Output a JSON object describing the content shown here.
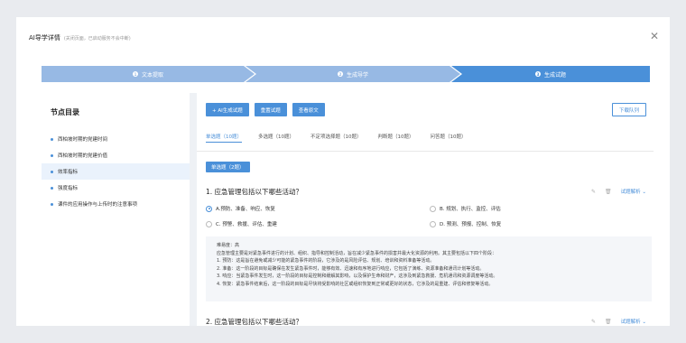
{
  "header": {
    "title": "AI导学详情",
    "subtitle": "(关闭页面，已启动服务不会中断)"
  },
  "steps": [
    {
      "num": "1",
      "label": "文本提取"
    },
    {
      "num": "2",
      "label": "生成导学"
    },
    {
      "num": "3",
      "label": "生成试题"
    }
  ],
  "sidebar": {
    "title": "节点目录",
    "items": [
      {
        "label": "西柏坡时期的党建时间"
      },
      {
        "label": "西柏坡时期的党建价值"
      },
      {
        "label": "效率指标"
      },
      {
        "label": "强度指标"
      },
      {
        "label": "课件的应用操作与上传时的注意事项"
      }
    ]
  },
  "toolbar": {
    "ai_generate": "+ AI生成试题",
    "regenerate": "重置试题",
    "view_original": "查看原文",
    "download": "下载队列"
  },
  "tabs": [
    {
      "label": "单选题（10题）"
    },
    {
      "label": "多选题（10题）"
    },
    {
      "label": "不定项选择题（10题）"
    },
    {
      "label": "判断题（10题）"
    },
    {
      "label": "问答题（10题）"
    }
  ],
  "section": {
    "badge": "单选题（2题）"
  },
  "questions": [
    {
      "title": "1. 应急管理包括以下哪些活动？",
      "options": [
        "A.预防、准备、响应、恢复",
        "B. 规划、执行、监控、评估",
        "C. 预警、救援、评估、重建",
        "D. 预测、预报、控制、恢复"
      ],
      "analysis_label": "试题解析 ⌄",
      "difficulty": "难易度：高",
      "explanation": [
        "应急管理主要是对紧急事件进行的计划、组织、指导和控制活动，旨在减少紧急事件的损害并最大化资源的利用。其主要包括以下四个阶段：",
        "1. 预防：这是旨在避免或减少可能的紧急事件的阶段，它涉及的是风险评估、规划、培训和资料准备等活动。",
        "2. 准备：这一阶段的目标是确保在发生紧急事件时，能够有效、迅速和有序地进行响应，它包括了演练、资源准备和通讯计划等活动。",
        "3. 响应：当紧急事件发生时，这一阶段的目标是控制和缓解其影响，以及保护生命和财产，这涉及到紧急救援、危机通讯和资源调度等活动。",
        "4. 恢复：紧急事件结束后，这一阶段的目标是尽快将受影响的社区或组织恢复到正常或更好的状态，它涉及的是重建、评估和修复等活动。"
      ]
    },
    {
      "title": "2. 应急管理包括以下哪些活动？",
      "analysis_label": "试题解析 ⌄"
    }
  ],
  "colors": {
    "accent": "#4a90d9",
    "step_done": "#97b9e4",
    "active_row": "#eaf2fc"
  },
  "icons": [
    "close-icon",
    "edit-icon",
    "delete-icon",
    "radio-icon"
  ]
}
